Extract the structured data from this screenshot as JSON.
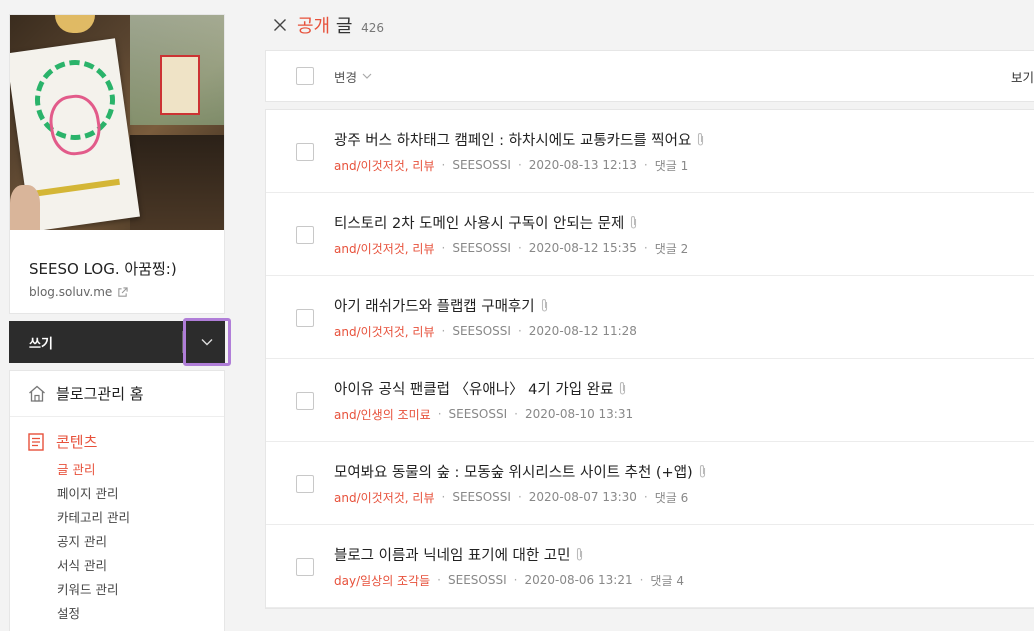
{
  "profile": {
    "blog_name": "SEESO LOG. 아꿈찡:)",
    "blog_url": "blog.soluv.me"
  },
  "write": {
    "label": "쓰기"
  },
  "menu": {
    "home_label": "블로그관리 홈",
    "contents_label": "콘텐츠",
    "items": [
      "글 관리",
      "페이지 관리",
      "카테고리 관리",
      "공지 관리",
      "서식 관리",
      "키워드 관리",
      "설정"
    ]
  },
  "header": {
    "title_accent": "공개",
    "title_rest": "글",
    "count": "426"
  },
  "toolbar": {
    "change_label": "변경",
    "view_label": "보기"
  },
  "posts": [
    {
      "title": "광주 버스 하차태그 캠페인 : 하차시에도 교통카드를 찍어요",
      "category": "and/이것저것, 리뷰",
      "author": "SEESOSSI",
      "date": "2020-08-13 12:13",
      "comments": "댓글 1"
    },
    {
      "title": "티스토리 2차 도메인 사용시 구독이 안되는 문제",
      "category": "and/이것저것, 리뷰",
      "author": "SEESOSSI",
      "date": "2020-08-12 15:35",
      "comments": "댓글 2"
    },
    {
      "title": "아기 래쉬가드와 플랩캡 구매후기",
      "category": "and/이것저것, 리뷰",
      "author": "SEESOSSI",
      "date": "2020-08-12 11:28",
      "comments": ""
    },
    {
      "title": "아이유 공식 팬클럽 〈유애나〉 4기 가입 완료",
      "category": "and/인생의 조미료",
      "author": "SEESOSSI",
      "date": "2020-08-10 13:31",
      "comments": ""
    },
    {
      "title": "모여봐요 동물의 숲 : 모동숲 위시리스트 사이트 추천 (+앱)",
      "category": "and/이것저것, 리뷰",
      "author": "SEESOSSI",
      "date": "2020-08-07 13:30",
      "comments": "댓글 6"
    },
    {
      "title": "블로그 이름과 닉네임 표기에 대한 고민",
      "category": "day/일상의 조각들",
      "author": "SEESOSSI",
      "date": "2020-08-06 13:21",
      "comments": "댓글 4"
    }
  ],
  "colors": {
    "accent": "#e7513b",
    "toggle_outline": "#b07ed8"
  }
}
